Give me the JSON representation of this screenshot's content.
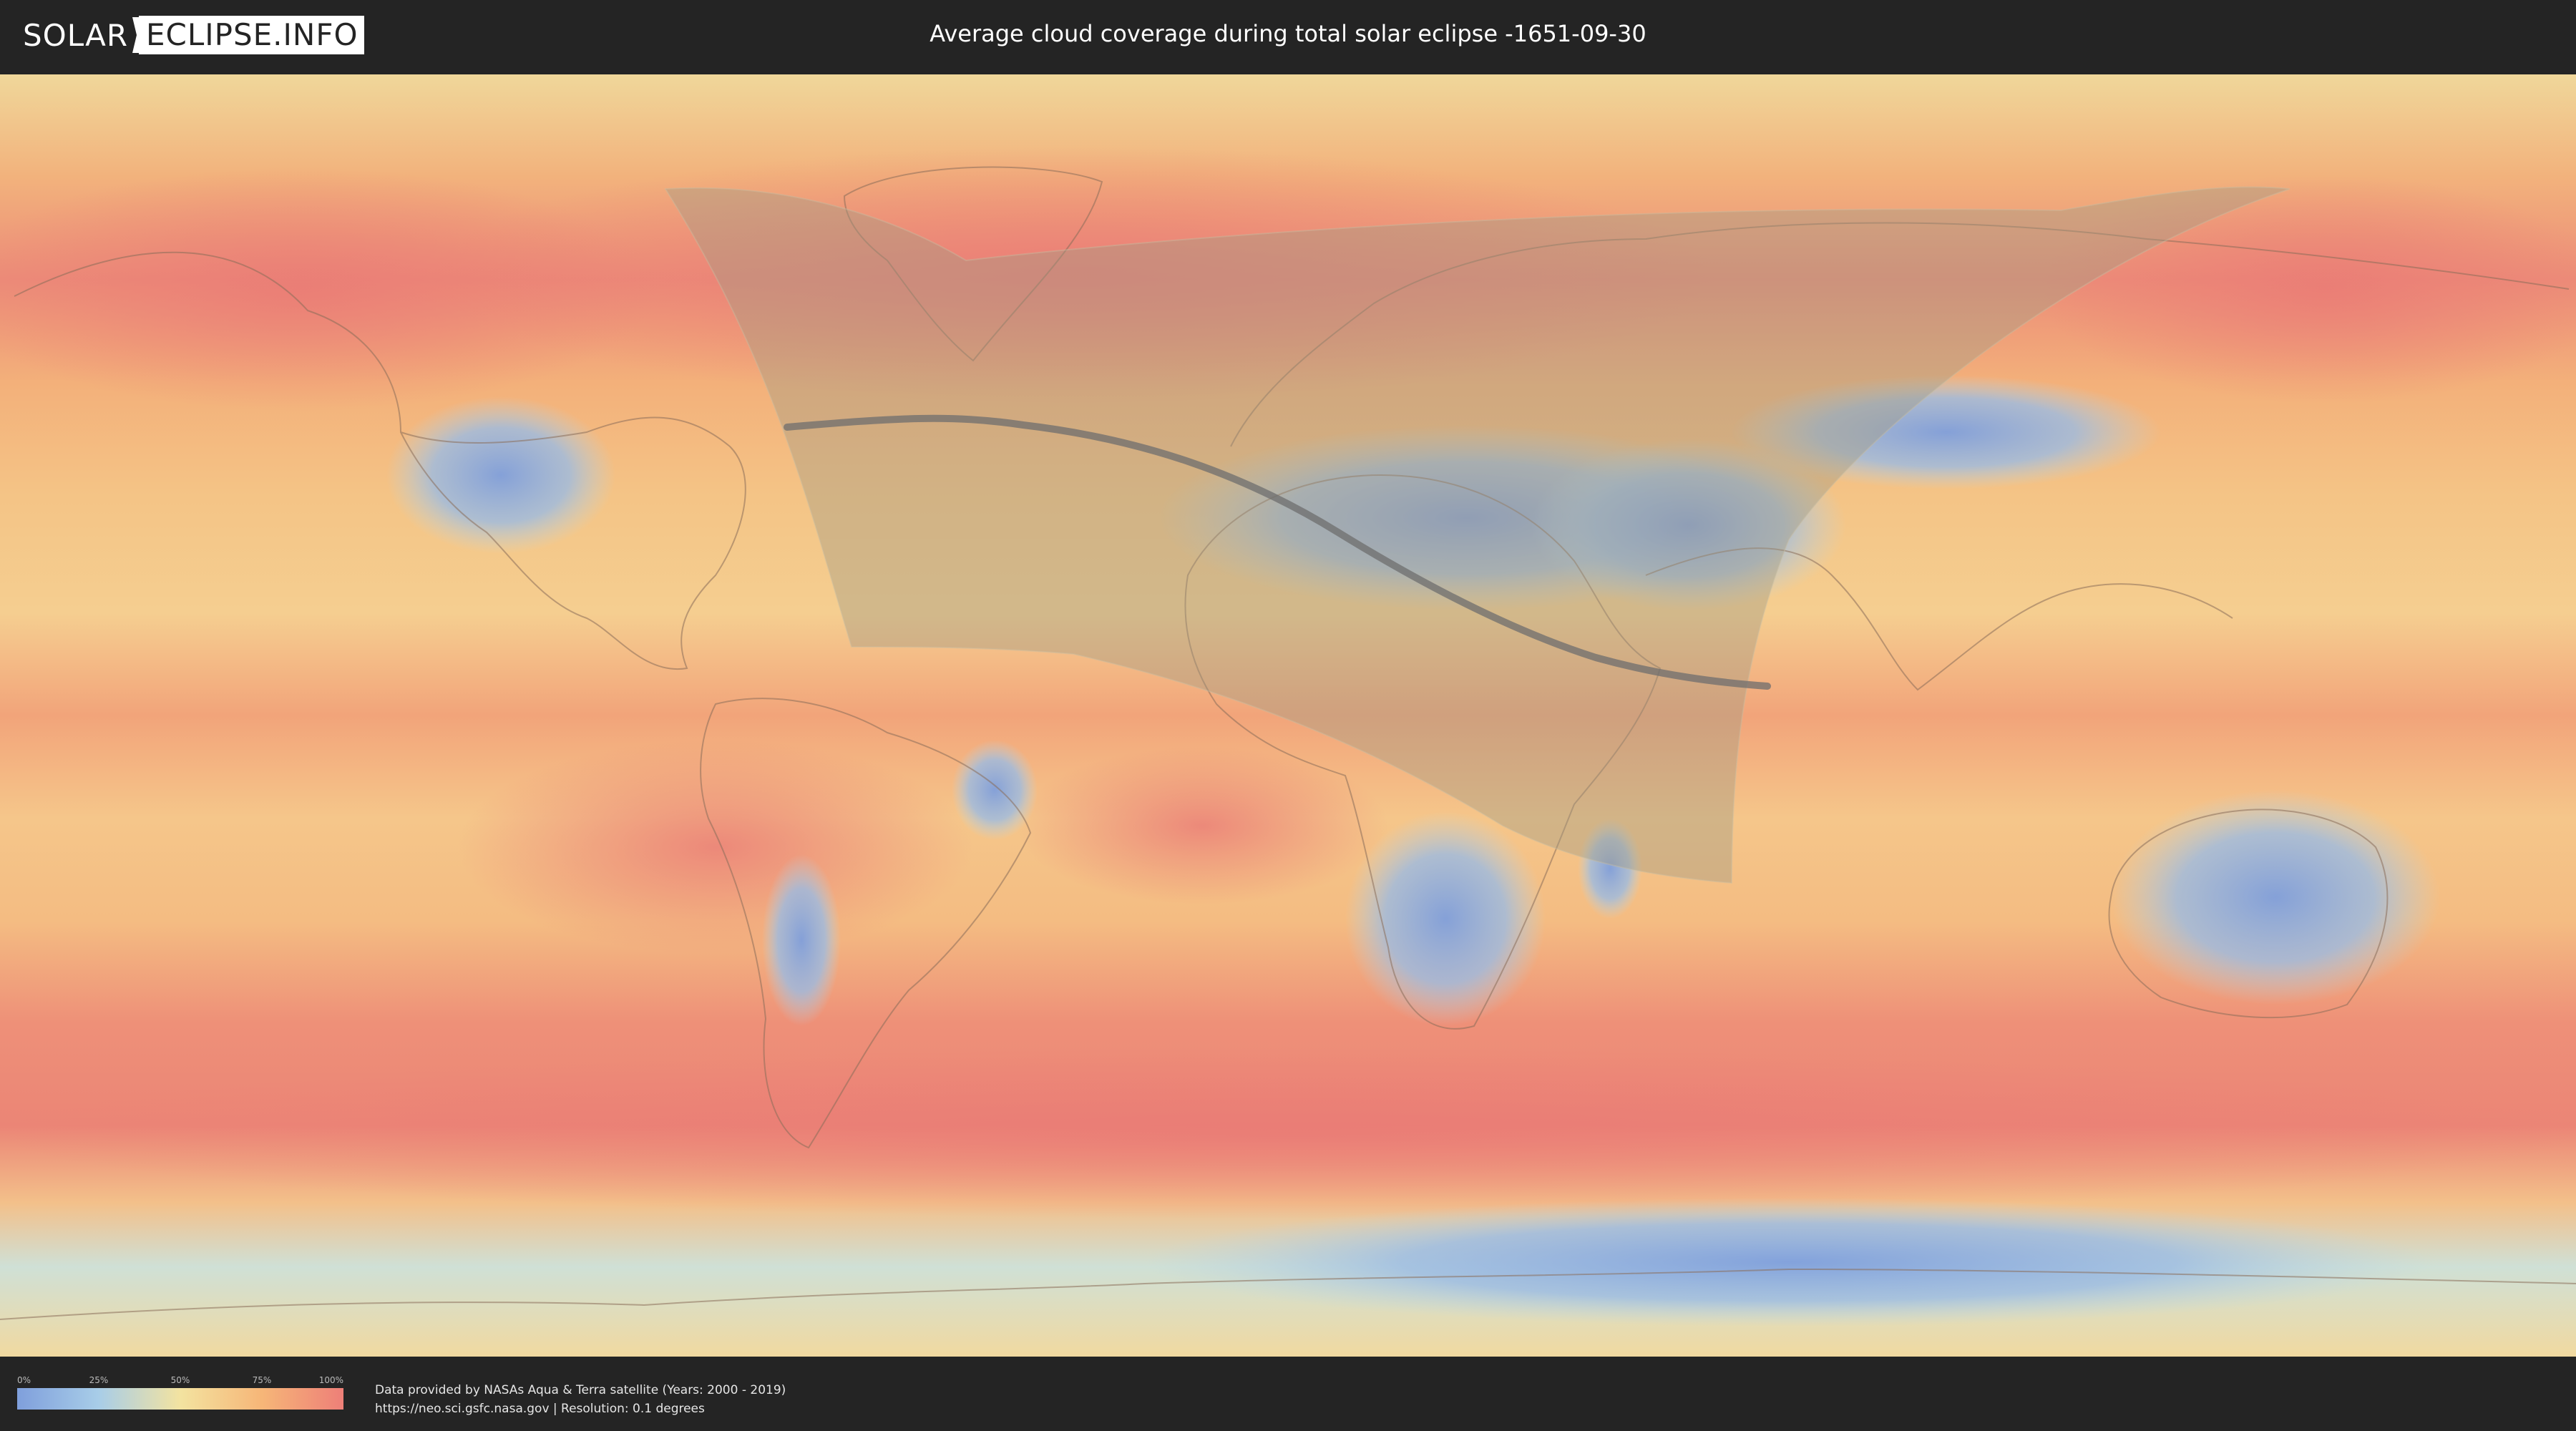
{
  "header": {
    "logo_left": "SOLAR",
    "logo_right": "ECLIPSE.INFO",
    "title": "Average cloud coverage during total solar eclipse -1651-09-30"
  },
  "map": {
    "colors": {
      "clear": "#7f9fdc",
      "low": "#a8cde8",
      "mid": "#f3e3a0",
      "high": "#f6b678",
      "overcast": "#ee7f78",
      "shadow_overlay": "#9a8f74",
      "path_line": "#6e6e6e"
    }
  },
  "legend": {
    "ticks": [
      "0%",
      "25%",
      "50%",
      "75%",
      "100%"
    ]
  },
  "footer": {
    "credit_line": "Data provided by NASAs Aqua & Terra satellite (Years: 2000 - 2019)",
    "source_line": "https://neo.sci.gsfc.nasa.gov | Resolution: 0.1 degrees"
  }
}
